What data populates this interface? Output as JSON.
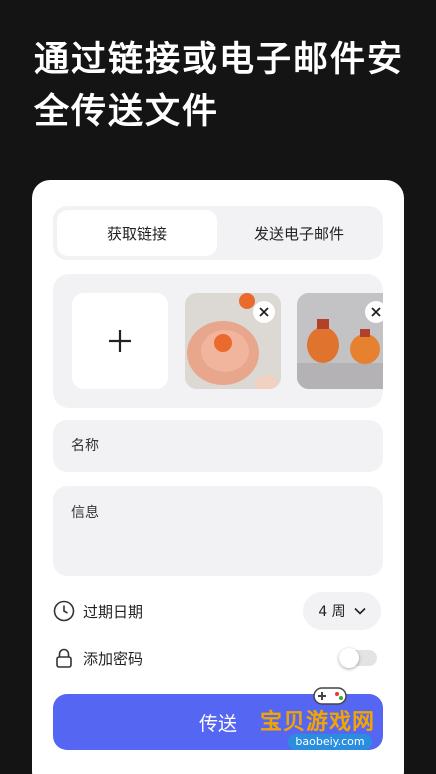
{
  "headline": "通过链接或电子邮件安全传送文件",
  "tabs": [
    {
      "label": "获取链接",
      "active": true
    },
    {
      "label": "发送电子邮件",
      "active": false
    }
  ],
  "form": {
    "name_placeholder": "名称",
    "message_placeholder": "信息",
    "expiry_label": "过期日期",
    "expiry_value": "4 周",
    "password_label": "添加密码",
    "password_enabled": false,
    "send_label": "传送"
  },
  "watermark": {
    "text": "宝贝游戏网",
    "url": "baobeiy.com"
  },
  "colors": {
    "background": "#141414",
    "accent": "#5566f2",
    "card": "#ffffff",
    "field": "#f2f2f4"
  }
}
